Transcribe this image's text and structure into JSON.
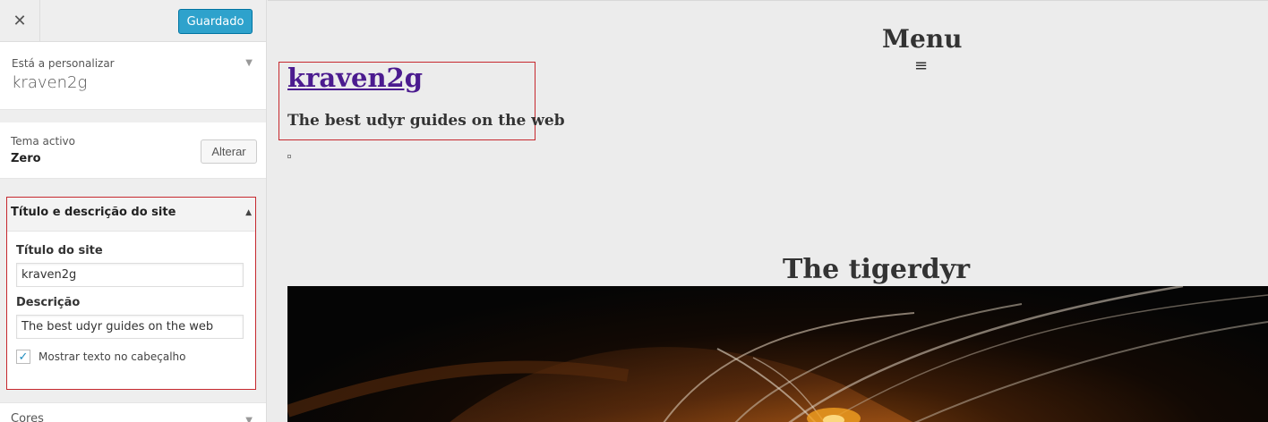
{
  "sidebar": {
    "close_icon": "close-icon",
    "save_label": "Guardado",
    "customizing_label": "Está a personalizar",
    "site_name": "kraven2g",
    "active_theme_label": "Tema activo",
    "active_theme_name": "Zero",
    "change_label": "Alterar",
    "section_title": "Título e descrição do site",
    "site_title_label": "Título do site",
    "site_title_value": "kraven2g",
    "description_label": "Descrição",
    "description_value": "The best udyr guides on the web",
    "show_header_text_label": "Mostrar texto no cabeçalho",
    "show_header_text_checked": true,
    "colors_label": "Cores"
  },
  "preview": {
    "menu_title": "Menu",
    "menu_icon": "hamburger-icon",
    "site_title": "kraven2g",
    "site_description": "The best udyr guides on the web",
    "post_title": "The tigerdyr"
  },
  "colors": {
    "save_button": "#2ea2cc",
    "highlight_border": "#c6282e",
    "site_title_link": "#4b1b8f"
  }
}
